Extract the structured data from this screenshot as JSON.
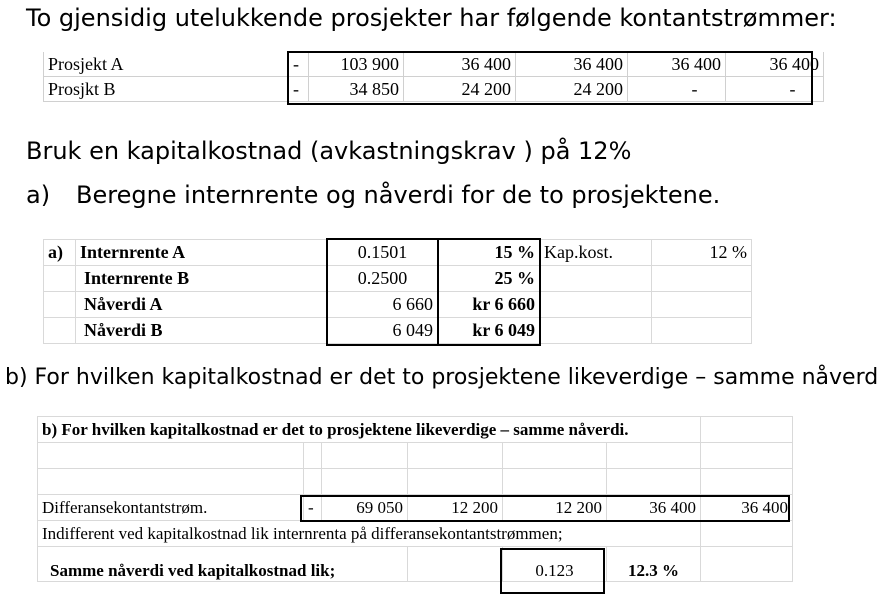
{
  "heading": "To gjensidig utelukkende prosjekter har følgende kontantstrømmer:",
  "cashflows": {
    "rows": [
      {
        "label": "Prosjekt A",
        "sign": "-",
        "values": [
          "103 900",
          "36 400",
          "36 400",
          "36 400",
          "36 400"
        ]
      },
      {
        "label": "Prosjkt B",
        "sign": "-",
        "values": [
          "34 850",
          "24 200",
          "24 200",
          "-",
          "-"
        ]
      }
    ]
  },
  "capital_cost_text": "Bruk en kapitalkostnad (avkastningskrav ) på 12%",
  "question_a": {
    "marker": "a)",
    "text": "Beregne internrente og nåverdi for de to prosjektene."
  },
  "table_a": {
    "marker": "a)",
    "rows": [
      {
        "label": "Internrente A",
        "value": "0.1501",
        "formatted": "15 %"
      },
      {
        "label": "Internrente B",
        "value": "0.2500",
        "formatted": "25 %"
      },
      {
        "label": "Nåverdi A",
        "value": "6 660",
        "formatted": "kr 6 660"
      },
      {
        "label": "Nåverdi B",
        "value": "6 049",
        "formatted": "kr 6 049"
      }
    ],
    "kapkost_label": "Kap.kost.",
    "kapkost_value": "12 %"
  },
  "question_b": "b) For hvilken kapitalkostnad er det to prosjektene likeverdige – samme nåverdi.",
  "table_b": {
    "title": "b) For hvilken kapitalkostnad er det to prosjektene likeverdige – samme nåverdi.",
    "diff_label": "Differansekontantstrøm.",
    "diff_sign": "-",
    "diff_values": [
      "69 050",
      "12 200",
      "12 200",
      "36 400",
      "36 400"
    ],
    "indifferent_text": "Indifferent ved kapitalkostnad lik internrenta på differansekontantstrømmen;",
    "same_npv_label": "Samme nåverdi ved kapitalkostnad lik;",
    "same_npv_value": "0.123",
    "same_npv_formatted": "12.3 %"
  }
}
